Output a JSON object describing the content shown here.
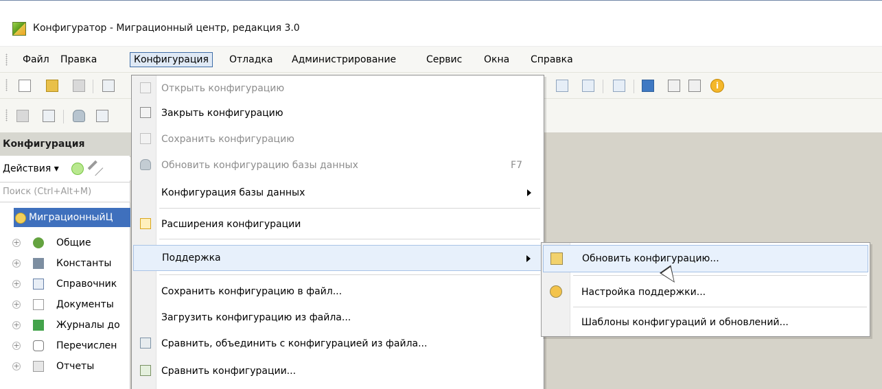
{
  "window": {
    "title": "Конфигуратор - Миграционный центр, редакция 3.0",
    "app_icon": "1c-configurator-icon"
  },
  "menubar": {
    "items": [
      {
        "label": "Файл",
        "active": false
      },
      {
        "label": "Правка",
        "active": false
      },
      {
        "label": "Конфигурация",
        "active": true
      },
      {
        "label": "Отладка",
        "active": false
      },
      {
        "label": "Администрирование",
        "active": false
      },
      {
        "label": "Сервис",
        "active": false
      },
      {
        "label": "Окна",
        "active": false
      },
      {
        "label": "Справка",
        "active": false
      }
    ]
  },
  "toolbar": {
    "icons": [
      "new-document-icon",
      "open-folder-icon",
      "save-icon",
      "cut-icon",
      "search-back-icon",
      "search-forward-icon",
      "window-icon",
      "education-icon",
      "help-search-icon",
      "book-icon",
      "info-icon"
    ]
  },
  "left_panel": {
    "title": "Конфигурация",
    "actions_label": "Действия",
    "search_placeholder": "Поиск (Ctrl+Alt+M)",
    "root_label": "МиграционныйЦ",
    "nodes": [
      {
        "label": "Общие",
        "icon": "common-objects-icon"
      },
      {
        "label": "Константы",
        "icon": "constants-icon"
      },
      {
        "label": "Справочник",
        "icon": "catalog-icon"
      },
      {
        "label": "Документы",
        "icon": "documents-icon"
      },
      {
        "label": "Журналы до",
        "icon": "journals-icon"
      },
      {
        "label": "Перечислен",
        "icon": "enums-icon"
      },
      {
        "label": "Отчеты",
        "icon": "reports-icon"
      }
    ]
  },
  "configuration_menu": {
    "items": [
      {
        "label": "Открыть конфигурацию",
        "disabled": true,
        "shortcut": "",
        "has_submenu": false,
        "icon": "open-config-icon"
      },
      {
        "label": "Закрыть конфигурацию",
        "disabled": false,
        "shortcut": "",
        "has_submenu": false,
        "icon": "close-config-icon"
      },
      {
        "label": "Сохранить конфигурацию",
        "disabled": true,
        "shortcut": "",
        "has_submenu": false,
        "icon": "save-config-icon"
      },
      {
        "label": "Обновить конфигурацию базы данных",
        "disabled": true,
        "shortcut": "F7",
        "has_submenu": false,
        "icon": "database-update-icon"
      },
      {
        "label": "Конфигурация базы данных",
        "disabled": false,
        "shortcut": "",
        "has_submenu": true,
        "icon": ""
      },
      {
        "label": "Расширения конфигурации",
        "disabled": false,
        "shortcut": "",
        "has_submenu": false,
        "icon": "extensions-icon"
      },
      {
        "label": "Поддержка",
        "disabled": false,
        "shortcut": "",
        "has_submenu": true,
        "icon": "",
        "highlighted": true
      },
      {
        "label": "Сохранить конфигурацию в файл...",
        "disabled": false,
        "shortcut": "",
        "has_submenu": false,
        "icon": ""
      },
      {
        "label": "Загрузить конфигурацию из файла...",
        "disabled": false,
        "shortcut": "",
        "has_submenu": false,
        "icon": ""
      },
      {
        "label": "Сравнить, объединить с конфигурацией из файла...",
        "disabled": false,
        "shortcut": "",
        "has_submenu": false,
        "icon": "compare-merge-icon"
      },
      {
        "label": "Сравнить конфигурации...",
        "disabled": false,
        "shortcut": "",
        "has_submenu": false,
        "icon": "compare-config-icon"
      }
    ]
  },
  "support_submenu": {
    "items": [
      {
        "label": "Обновить конфигурацию...",
        "highlighted": true,
        "icon": "update-config-icon"
      },
      {
        "label": "Настройка поддержки...",
        "highlighted": false,
        "icon": "support-settings-icon"
      },
      {
        "label": "Шаблоны конфигураций и обновлений...",
        "highlighted": false,
        "icon": ""
      }
    ]
  }
}
